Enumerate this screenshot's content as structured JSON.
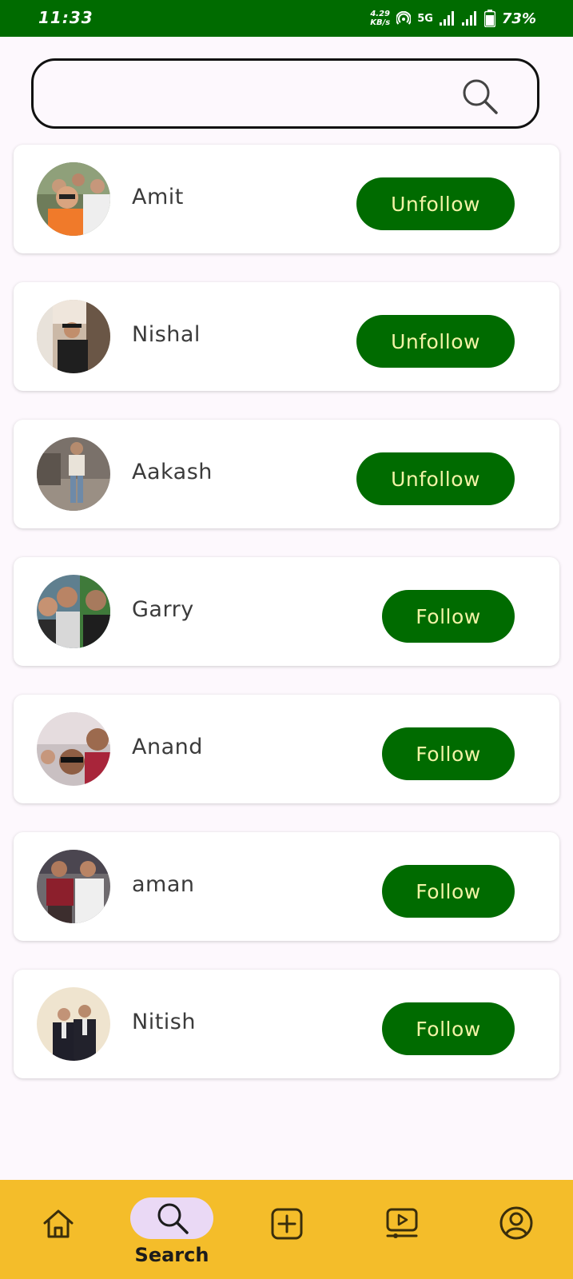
{
  "status_bar": {
    "time": "11:33",
    "net_speed_value": "4.29",
    "net_speed_unit": "KB/s",
    "network_type": "5G",
    "battery_pct": "73%"
  },
  "search": {
    "value": "",
    "placeholder": ""
  },
  "users": [
    {
      "name": "Amit",
      "action": "Unfollow"
    },
    {
      "name": "Nishal",
      "action": "Unfollow"
    },
    {
      "name": "Aakash",
      "action": "Unfollow"
    },
    {
      "name": "Garry",
      "action": "Follow"
    },
    {
      "name": "Anand",
      "action": "Follow"
    },
    {
      "name": "aman",
      "action": "Follow"
    },
    {
      "name": "Nitish",
      "action": "Follow"
    }
  ],
  "bottom_nav": {
    "items": [
      {
        "icon": "home-icon"
      },
      {
        "icon": "search-icon",
        "label": "Search",
        "active": true
      },
      {
        "icon": "add-post-icon"
      },
      {
        "icon": "video-icon"
      },
      {
        "icon": "profile-icon"
      }
    ]
  },
  "colors": {
    "primary": "#006b00",
    "button_text": "#f2f3a6",
    "nav_bg": "#f4bd2a",
    "nav_active_pill": "#ead9f5"
  }
}
